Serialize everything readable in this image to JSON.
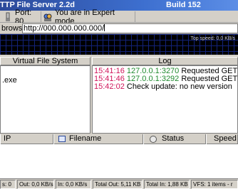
{
  "window": {
    "title": "TTP File Server 2.2d",
    "build": "Build 152"
  },
  "toolbar": {
    "port_label": "Port: 80",
    "mode_label": "You are in Expert mode"
  },
  "url_row": {
    "browser_label": "browser",
    "url_value": "http://000.000.000.000/"
  },
  "graph": {
    "speed_text": "Top speed: 0,0 KB/s"
  },
  "vfs": {
    "header": "Virtual File System",
    "items": [
      ".exe"
    ]
  },
  "log": {
    "header": "Log",
    "entries": [
      {
        "time": "15:41:16",
        "ip": "127.0.0.1:3270",
        "msg": "Requested GET /"
      },
      {
        "time": "15:41:46",
        "ip": "127.0.0.1:3292",
        "msg": "Requested GET /"
      },
      {
        "time": "15:42:02",
        "ip": "",
        "msg": "Check update: no new version"
      }
    ]
  },
  "connections": {
    "columns": [
      "IP",
      "Filename",
      "Status",
      "Speed"
    ]
  },
  "statusbar": {
    "items": [
      "s: 0",
      "Out: 0,0 KB/s",
      "In: 0,0 KB/s",
      "Total Out: 5,11 KB",
      "Total In: 1,88 KB",
      "VFS: 1 items - r"
    ]
  },
  "colors": {
    "log_time": "#d0145a",
    "log_ip": "#1f8a2e",
    "title_bar": "#3d6fcf",
    "graph_bg": "#000000"
  }
}
